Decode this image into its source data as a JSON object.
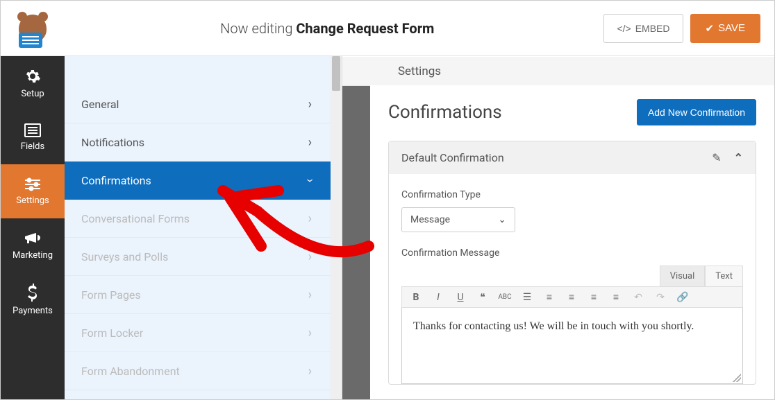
{
  "topbar": {
    "editing_prefix": "Now editing",
    "form_name": "Change Request Form",
    "embed_label": "EMBED",
    "save_label": "SAVE"
  },
  "leftnav": [
    {
      "id": "setup",
      "icon": "gear",
      "label": "Setup"
    },
    {
      "id": "fields",
      "icon": "list",
      "label": "Fields"
    },
    {
      "id": "settings",
      "icon": "sliders",
      "label": "Settings"
    },
    {
      "id": "marketing",
      "icon": "megaphone",
      "label": "Marketing"
    },
    {
      "id": "payments",
      "icon": "dollar",
      "label": "Payments"
    }
  ],
  "settings_header": "Settings",
  "subnav": [
    {
      "label": "General",
      "state": "normal"
    },
    {
      "label": "Notifications",
      "state": "normal"
    },
    {
      "label": "Confirmations",
      "state": "active"
    },
    {
      "label": "Conversational Forms",
      "state": "muted"
    },
    {
      "label": "Surveys and Polls",
      "state": "muted"
    },
    {
      "label": "Form Pages",
      "state": "muted"
    },
    {
      "label": "Form Locker",
      "state": "muted"
    },
    {
      "label": "Form Abandonment",
      "state": "muted"
    }
  ],
  "main": {
    "heading": "Confirmations",
    "add_button": "Add New Confirmation",
    "panel_title": "Default Confirmation",
    "type_label": "Confirmation Type",
    "type_value": "Message",
    "message_label": "Confirmation Message",
    "tabs": {
      "visual": "Visual",
      "text": "Text"
    },
    "message_body": "Thanks for contacting us! We will be in touch with you shortly."
  }
}
